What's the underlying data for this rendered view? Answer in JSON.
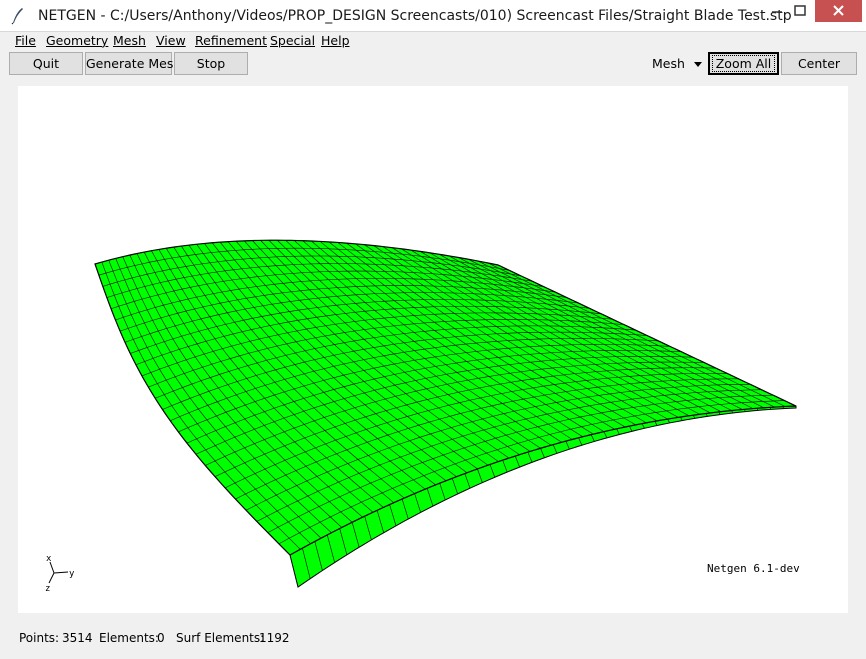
{
  "window": {
    "title": "NETGEN - C:/Users/Anthony/Videos/PROP_DESIGN Screencasts/010) Screencast Files/Straight Blade Test.stp",
    "icons": {
      "app": "quill-icon",
      "minimize": "minimize-icon",
      "maximize": "maximize-icon",
      "close": "close-icon"
    }
  },
  "menu": {
    "file": "File",
    "geometry": "Geometry",
    "mesh": "Mesh",
    "view": "View",
    "refinement": "Refinement",
    "special": "Special",
    "help": "Help"
  },
  "toolbar": {
    "quit": "Quit",
    "generate_mesh": "Generate Mesh",
    "stop": "Stop",
    "view_mode": "Mesh",
    "zoom_all": "Zoom All",
    "center": "Center"
  },
  "viewport": {
    "version": "Netgen 6.1-dev",
    "axes": {
      "x": "x",
      "y": "y",
      "z": "z"
    },
    "mesh_color": "#00ff00",
    "edge_color": "#000000",
    "background": "#ffffff"
  },
  "status": {
    "points_label": "Points:",
    "points": "3514",
    "elements_label": "Elements:",
    "elements": "0",
    "surf_elements_label": "Surf Elements:",
    "surf_elements": "1192"
  }
}
